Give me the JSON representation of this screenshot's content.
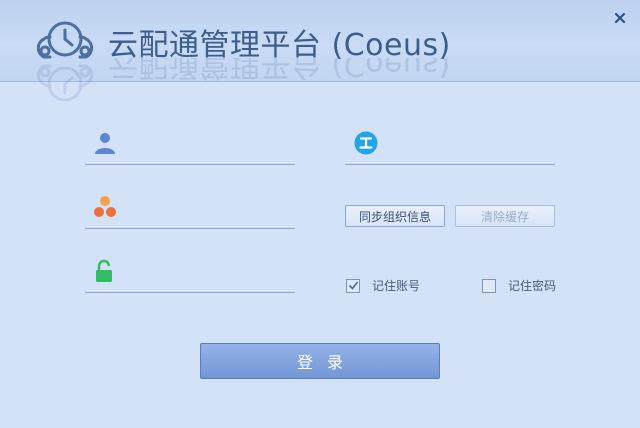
{
  "app": {
    "title": "云配通管理平台 (Coeus)"
  },
  "window": {
    "close_glyph": "×"
  },
  "form": {
    "username": {
      "value": "",
      "placeholder": ""
    },
    "org": {
      "value": "",
      "placeholder": ""
    },
    "password": {
      "value": "",
      "placeholder": ""
    },
    "server": {
      "value": "",
      "placeholder": ""
    },
    "sync_button": "同步组织信息",
    "clear_cache_button": "清除缓存",
    "remember_account": {
      "label": "记住账号",
      "checked": true
    },
    "remember_password": {
      "label": "记住密码",
      "checked": false
    },
    "login_button": "登录"
  },
  "icons": {
    "logo": "cloud-clock-logo",
    "username": "user-icon",
    "org": "organization-icon",
    "password": "unlock-icon",
    "server": "server-icon"
  },
  "colors": {
    "background": "#d4e2f8",
    "header": "#c4d7f3",
    "title_text": "#3e5d8a",
    "login_button": "#7e9fdc",
    "user_icon": "#5b86d6",
    "org_icon_top": "#f5a04d",
    "org_icon_bottom": "#ee6f3b",
    "lock_icon": "#33bb66",
    "server_icon": "#22a4e8"
  }
}
